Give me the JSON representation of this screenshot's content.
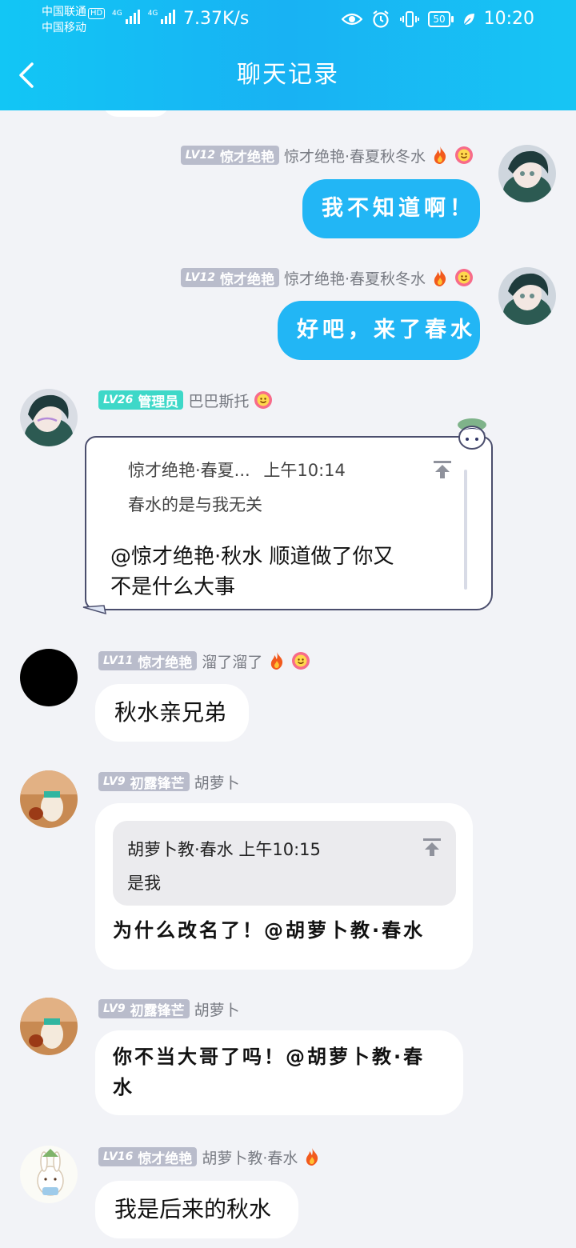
{
  "status_bar": {
    "carrier_1": "中国联通",
    "hd": "HD",
    "carrier_2": "中国移动",
    "net_label": "4G",
    "net_speed": "7.37K/s",
    "battery": "50",
    "time": "10:20"
  },
  "header": {
    "title": "聊天记录"
  },
  "colors": {
    "header": "#18b2f3",
    "bubble_blue": "#22b6f5",
    "badge_gray": "#b9bccb",
    "badge_teal": "#3ed8c8"
  },
  "messages": [
    {
      "level": "LV12",
      "title": "惊才绝艳",
      "nick": "惊才绝艳·春夏秋冬水",
      "text": "我不知道啊！",
      "side": "right"
    },
    {
      "level": "LV12",
      "title": "惊才绝艳",
      "nick": "惊才绝艳·春夏秋冬水",
      "text": "好吧，来了春水",
      "side": "right"
    },
    {
      "level": "LV26",
      "title": "管理员",
      "nick": "巴巴斯托",
      "quote_author": "惊才绝艳·春夏...",
      "quote_time": "上午10:14",
      "quote_text": "春水的是与我无关",
      "text_1": "@惊才绝艳·秋水 顺道做了你又",
      "text_2": "不是什么大事"
    },
    {
      "level": "LV11",
      "title": "惊才绝艳",
      "nick": "溜了溜了",
      "text": "秋水亲兄弟"
    },
    {
      "level": "LV9",
      "title": "初露锋芒",
      "nick": "胡萝卜",
      "quote_head": "胡萝卜教·春水 上午10:15",
      "quote_text": "是我",
      "text": "为什么改名了！@胡萝卜教·春水"
    },
    {
      "level": "LV9",
      "title": "初露锋芒",
      "nick": "胡萝卜",
      "text_1": "你不当大哥了吗！@胡萝卜教·春",
      "text_2": "水"
    },
    {
      "level": "LV16",
      "title": "惊才绝艳",
      "nick": "胡萝卜教·春水",
      "text": "我是后来的秋水"
    }
  ]
}
